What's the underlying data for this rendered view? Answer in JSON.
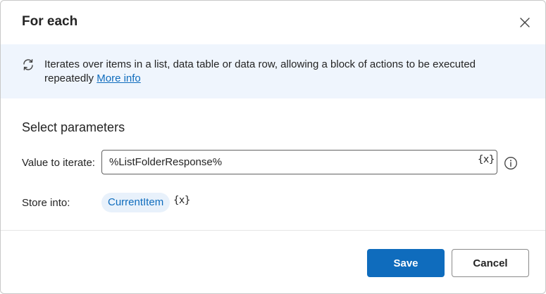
{
  "dialog": {
    "title": "For each",
    "close_icon": "close-icon"
  },
  "info": {
    "icon": "loop-icon",
    "text": "Iterates over items in a list, data table or data row, allowing a block of actions to be executed repeatedly",
    "link_label": "More info"
  },
  "params": {
    "section_title": "Select parameters",
    "value_to_iterate": {
      "label": "Value to iterate:",
      "value": "%ListFolderResponse%",
      "var_button": "{x}"
    },
    "store_into": {
      "label": "Store into:",
      "variable": "CurrentItem",
      "var_button": "{x}"
    }
  },
  "footer": {
    "save_label": "Save",
    "cancel_label": "Cancel"
  },
  "colors": {
    "accent": "#0f6cbd",
    "banner_bg": "#eff5fd",
    "chip_bg": "#e8f1fb"
  }
}
